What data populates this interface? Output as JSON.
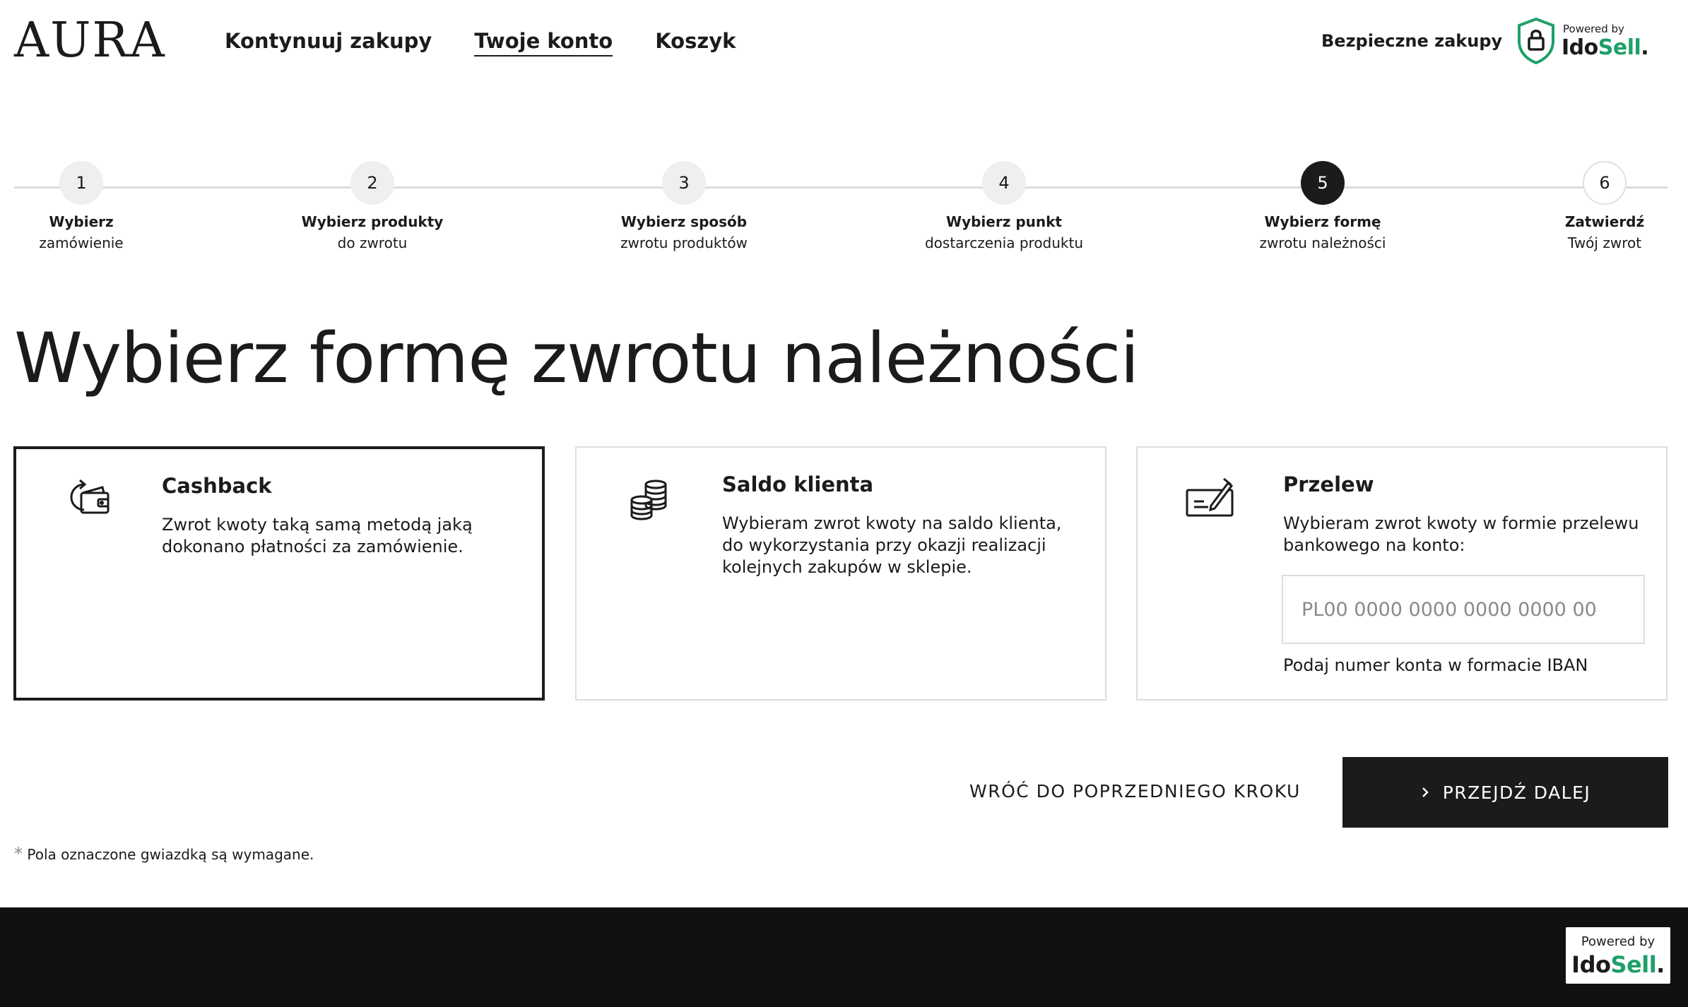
{
  "header": {
    "logo": "AURA",
    "nav": [
      {
        "label": "Kontynuuj zakupy",
        "active": false
      },
      {
        "label": "Twoje konto",
        "active": true
      },
      {
        "label": "Koszyk",
        "active": false
      }
    ],
    "secure_label": "Bezpieczne zakupy",
    "badge": {
      "powered": "Powered by",
      "brand_a": "Ido",
      "brand_b": "Sell",
      "brand_dot": "."
    }
  },
  "steps": [
    {
      "number": "1",
      "title": "Wybierz",
      "subtitle": "zamówienie",
      "state": "done"
    },
    {
      "number": "2",
      "title": "Wybierz produkty",
      "subtitle": "do zwrotu",
      "state": "done"
    },
    {
      "number": "3",
      "title": "Wybierz sposób",
      "subtitle": "zwrotu produktów",
      "state": "done"
    },
    {
      "number": "4",
      "title": "Wybierz punkt",
      "subtitle": "dostarczenia produktu",
      "state": "done"
    },
    {
      "number": "5",
      "title": "Wybierz formę",
      "subtitle": "zwrotu należności",
      "state": "current"
    },
    {
      "number": "6",
      "title": "Zatwierdź",
      "subtitle": "Twój zwrot",
      "state": "upcoming"
    }
  ],
  "page_title": "Wybierz formę zwrotu należności",
  "options": [
    {
      "title": "Cashback",
      "description": "Zwrot kwoty taką samą metodą jaką dokonano płatności za zamówienie.",
      "icon": "cashback-wallet-icon",
      "selected": true
    },
    {
      "title": "Saldo klienta",
      "description": "Wybieram zwrot kwoty na saldo klienta, do wykorzystania przy okazji realizacji kolejnych zakupów w sklepie.",
      "icon": "coins-stack-icon",
      "selected": false
    },
    {
      "title": "Przelew",
      "description": "Wybieram zwrot kwoty w formie przelewu bankowego na konto:",
      "icon": "bank-transfer-icon",
      "selected": false,
      "iban_placeholder": "PL00 0000 0000 0000 0000 00",
      "iban_value": "",
      "iban_hint": "Podaj numer konta w formacie IBAN"
    }
  ],
  "actions": {
    "back_label": "WRÓĆ DO POPRZEDNIEGO KROKU",
    "next_label": "PRZEJDŹ DALEJ"
  },
  "required_note": {
    "star": "*",
    "text": "Pola oznaczone gwiazdką są wymagane."
  },
  "footer": {
    "powered": "Powered by",
    "brand_a": "Ido",
    "brand_b": "Sell",
    "brand_dot": "."
  },
  "colors": {
    "accent_dark": "#1b1b1b",
    "brand_green": "#1ea068",
    "footer_bg": "#111111"
  }
}
